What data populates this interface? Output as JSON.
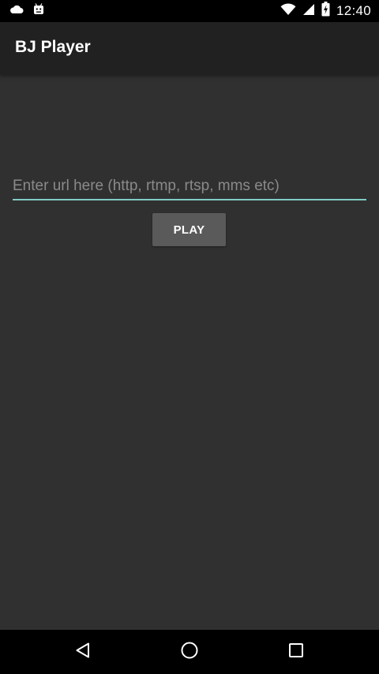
{
  "status_bar": {
    "time": "12:40",
    "left_icons": [
      "cloud-icon",
      "android-icon"
    ],
    "right_icons": [
      "wifi-icon",
      "signal-icon",
      "battery-icon"
    ]
  },
  "app_bar": {
    "title": "BJ Player"
  },
  "main": {
    "url_input": {
      "value": "",
      "placeholder": "Enter url here (http, rtmp, rtsp, mms etc)"
    },
    "play_button_label": "PLAY"
  },
  "nav_bar": {
    "buttons": [
      "back-icon",
      "home-icon",
      "recents-icon"
    ]
  },
  "colors": {
    "background": "#303030",
    "app_bar": "#212121",
    "accent": "#80cbc4",
    "button": "#5a5a5a"
  }
}
